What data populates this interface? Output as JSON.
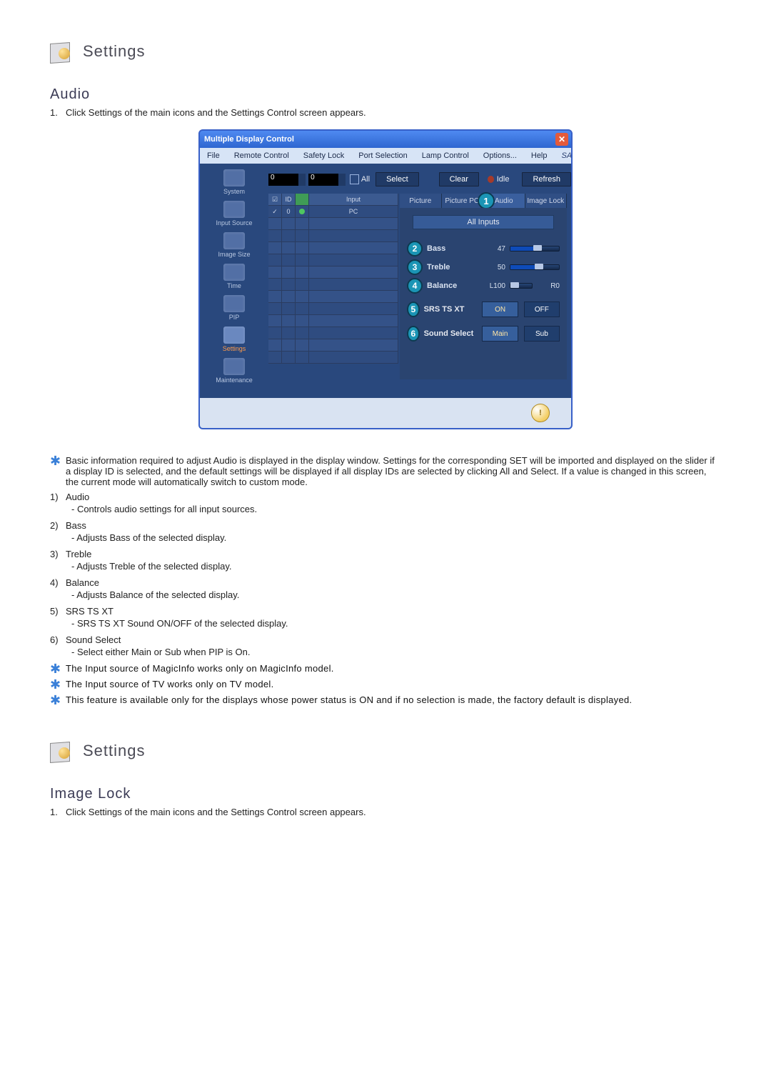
{
  "section1": {
    "title": "Settings",
    "sub": "Audio",
    "lead_num": "1.",
    "lead": "Click Settings of the main icons and the Settings Control screen appears."
  },
  "app": {
    "title": "Multiple Display Control",
    "menu": [
      "File",
      "Remote Control",
      "Safety Lock",
      "Port Selection",
      "Lamp Control",
      "Options...",
      "Help"
    ],
    "brand": "SAMSUNG DIGITall",
    "toolbar": {
      "sel1": "0",
      "sel2": "0",
      "all": "All",
      "select": "Select",
      "clear": "Clear",
      "idle": "Idle",
      "refresh": "Refresh"
    },
    "sidenav": [
      {
        "label": "System"
      },
      {
        "label": "Input Source"
      },
      {
        "label": "Image Size"
      },
      {
        "label": "Time"
      },
      {
        "label": "PIP"
      },
      {
        "label": "Settings",
        "sel": true
      },
      {
        "label": "Maintenance"
      }
    ],
    "grid": {
      "header": [
        "",
        "ID",
        "",
        "Input"
      ],
      "row1": [
        "✓",
        "0",
        "",
        "PC"
      ]
    },
    "tabs": [
      "Picture",
      "Picture PC",
      "Audio",
      "Image Lock"
    ],
    "panel": {
      "allInputs": "All Inputs",
      "bass": {
        "n": "2",
        "label": "Bass",
        "val": "47",
        "pct": 47
      },
      "treble": {
        "n": "3",
        "label": "Treble",
        "val": "50",
        "pct": 50
      },
      "balance": {
        "n": "4",
        "label": "Balance",
        "left": "L100",
        "right": "R0",
        "pct": 0
      },
      "srs": {
        "n": "5",
        "label": "SRS TS XT",
        "on": "ON",
        "off": "OFF"
      },
      "sound": {
        "n": "6",
        "label": "Sound Select",
        "main": "Main",
        "sub": "Sub"
      },
      "audioTabBadge": "1"
    }
  },
  "notes": {
    "star1": "Basic information required to adjust Audio is displayed in the display window. Settings for the corresponding SET will be imported and displayed on the slider if a display ID is selected, and the default settings will be displayed if all display IDs are selected by clicking All and Select. If a value is changed in this screen, the current mode will automatically switch to custom mode.",
    "items": [
      {
        "num": "1)",
        "label": "Audio",
        "sub": "- Controls audio settings for all input sources."
      },
      {
        "num": "2)",
        "label": "Bass",
        "sub": "- Adjusts Bass of the selected display."
      },
      {
        "num": "3)",
        "label": "Treble",
        "sub": "- Adjusts Treble of the selected display."
      },
      {
        "num": "4)",
        "label": "Balance",
        "sub": "- Adjusts Balance of the selected display."
      },
      {
        "num": "5)",
        "label": "SRS TS XT",
        "sub": "- SRS TS XT Sound ON/OFF of the selected display."
      },
      {
        "num": "6)",
        "label": "Sound Select",
        "sub": "- Select either Main or Sub when PIP is On."
      }
    ],
    "bold": [
      "The Input source of MagicInfo works only on MagicInfo model.",
      "The Input source of TV works only on TV model.",
      "This feature is available only for the displays whose power status is ON and if no selection is made, the factory default is displayed."
    ]
  },
  "section2": {
    "title": "Settings",
    "sub": "Image Lock",
    "lead_num": "1.",
    "lead": "Click Settings of the main icons and the Settings Control screen appears."
  }
}
